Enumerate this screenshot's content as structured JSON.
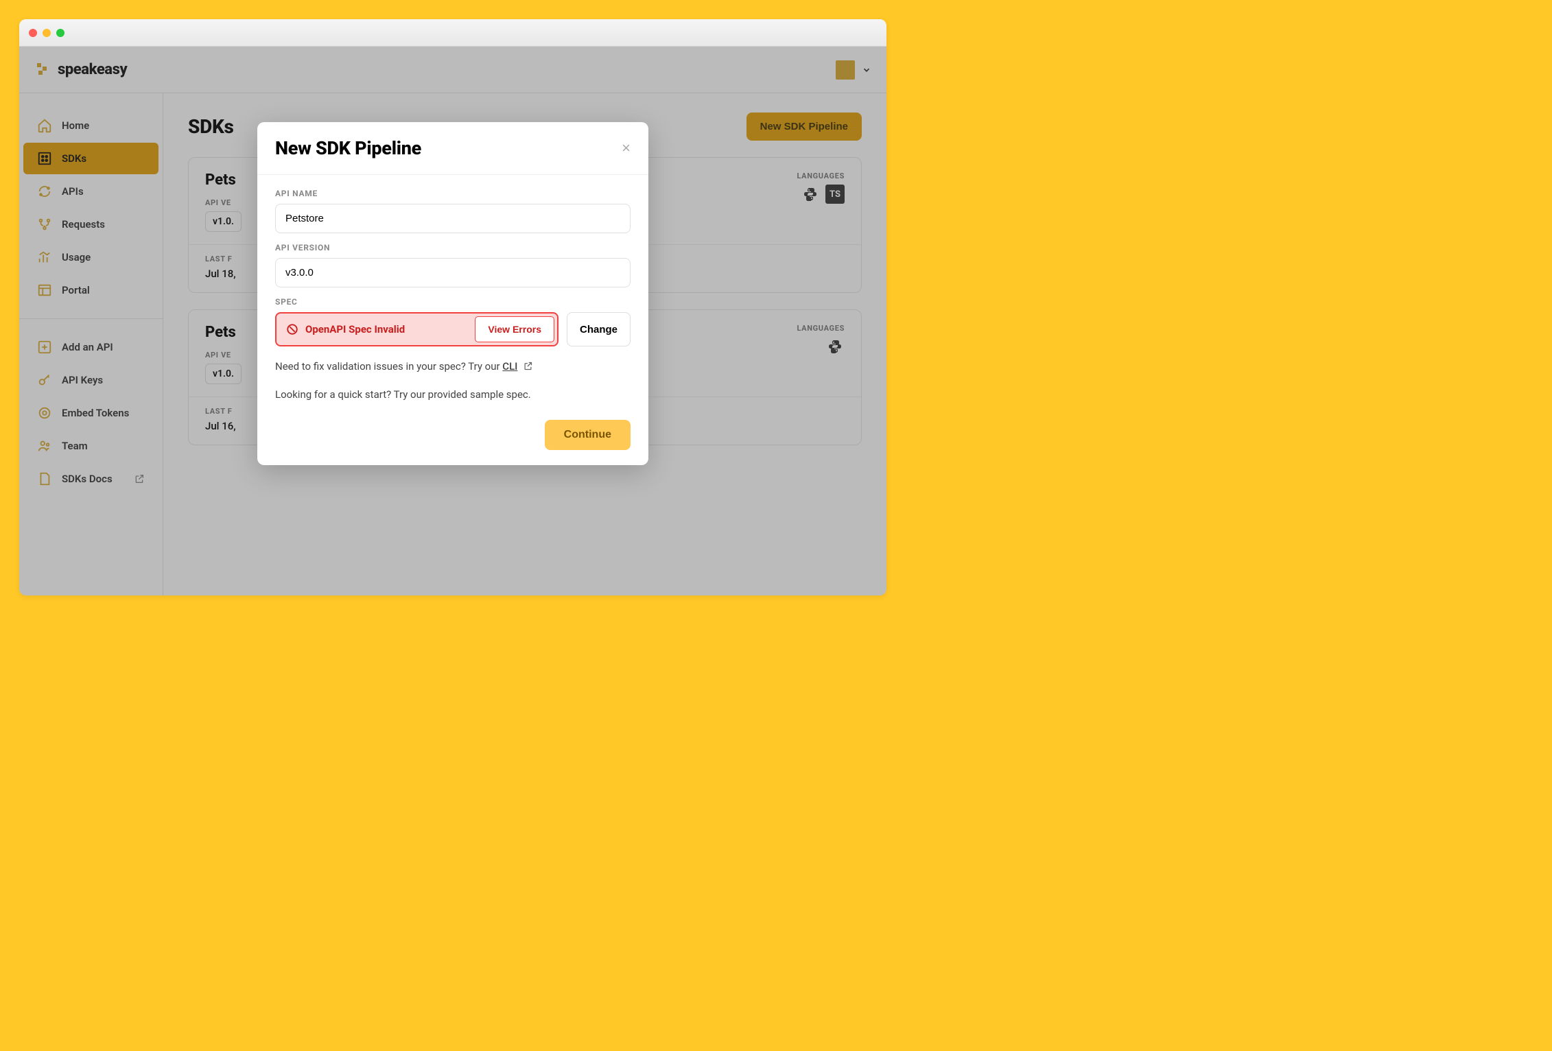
{
  "brand": {
    "name": "speakeasy"
  },
  "sidebar": {
    "items": [
      {
        "label": "Home"
      },
      {
        "label": "SDKs"
      },
      {
        "label": "APIs"
      },
      {
        "label": "Requests"
      },
      {
        "label": "Usage"
      },
      {
        "label": "Portal"
      }
    ],
    "secondary": [
      {
        "label": "Add an API"
      },
      {
        "label": "API Keys"
      },
      {
        "label": "Embed Tokens"
      },
      {
        "label": "Team"
      },
      {
        "label": "SDKs Docs"
      }
    ]
  },
  "main": {
    "title": "SDKs",
    "new_pipeline_btn": "New SDK Pipeline",
    "cards": [
      {
        "name": "Pets",
        "api_version_label": "API VE",
        "api_version": "v1.0.",
        "languages_label": "LANGUAGES",
        "languages": [
          "python",
          "typescript"
        ],
        "last_label": "LAST F",
        "last_value": "Jul 18,"
      },
      {
        "name": "Pets",
        "api_version_label": "API VE",
        "api_version": "v1.0.",
        "languages_label": "LANGUAGES",
        "languages": [
          "python"
        ],
        "last_label": "LAST F",
        "last_value": "Jul 16,"
      }
    ]
  },
  "modal": {
    "title": "New SDK Pipeline",
    "api_name_label": "API NAME",
    "api_name_value": "Petstore",
    "api_version_label": "API VERSION",
    "api_version_value": "v3.0.0",
    "spec_label": "SPEC",
    "spec_error": "OpenAPI Spec Invalid",
    "view_errors": "View Errors",
    "change": "Change",
    "hint1_pre": "Need to fix validation issues in your spec? Try our ",
    "hint1_link": "CLI",
    "hint2": "Looking for a quick start? Try our provided sample spec.",
    "continue": "Continue"
  }
}
